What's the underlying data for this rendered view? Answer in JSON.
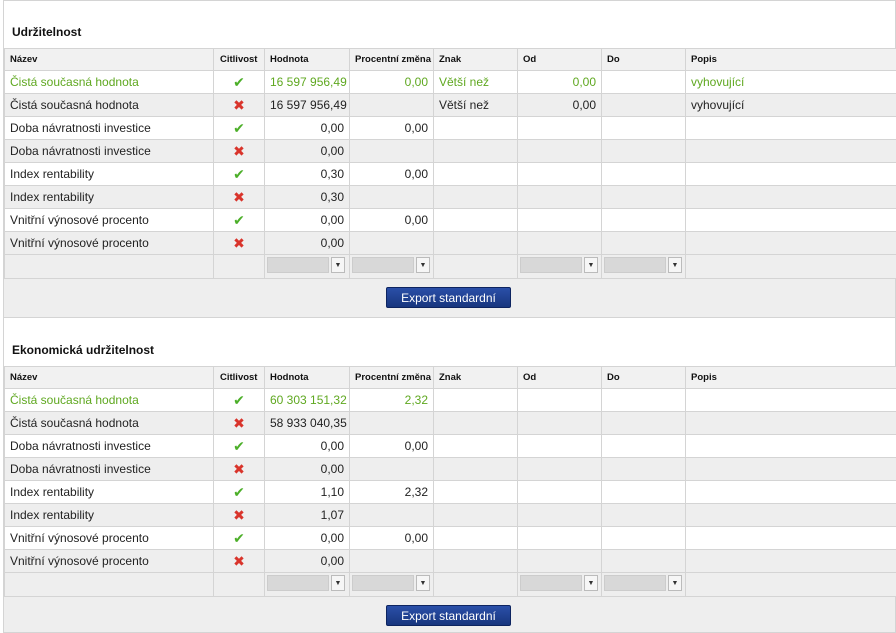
{
  "sections": [
    {
      "title": "Udržitelnost",
      "columns": [
        "Název",
        "Citlivost",
        "Hodnota",
        "Procentní změna",
        "Znak",
        "Od",
        "Do",
        "Popis"
      ],
      "rows": [
        {
          "name": "Čistá současná hodnota",
          "sens": "ok",
          "value": "16 597 956,49",
          "pct": "0,00",
          "sign": "Větší než",
          "from": "0,00",
          "to": "",
          "desc": "vyhovující",
          "green": true
        },
        {
          "name": "Čistá současná hodnota",
          "sens": "bad",
          "value": "16 597 956,49",
          "pct": "",
          "sign": "Větší než",
          "from": "0,00",
          "to": "",
          "desc": "vyhovující",
          "green": false
        },
        {
          "name": "Doba návratnosti investice",
          "sens": "ok",
          "value": "0,00",
          "pct": "0,00",
          "sign": "",
          "from": "",
          "to": "",
          "desc": "",
          "green": false
        },
        {
          "name": "Doba návratnosti investice",
          "sens": "bad",
          "value": "0,00",
          "pct": "",
          "sign": "",
          "from": "",
          "to": "",
          "desc": "",
          "green": false
        },
        {
          "name": "Index rentability",
          "sens": "ok",
          "value": "0,30",
          "pct": "0,00",
          "sign": "",
          "from": "",
          "to": "",
          "desc": "",
          "green": false
        },
        {
          "name": "Index rentability",
          "sens": "bad",
          "value": "0,30",
          "pct": "",
          "sign": "",
          "from": "",
          "to": "",
          "desc": "",
          "green": false
        },
        {
          "name": "Vnitřní výnosové procento",
          "sens": "ok",
          "value": "0,00",
          "pct": "0,00",
          "sign": "",
          "from": "",
          "to": "",
          "desc": "",
          "green": false
        },
        {
          "name": "Vnitřní výnosové procento",
          "sens": "bad",
          "value": "0,00",
          "pct": "",
          "sign": "",
          "from": "",
          "to": "",
          "desc": "",
          "green": false
        }
      ],
      "button": "Export standardní"
    },
    {
      "title": "Ekonomická udržitelnost",
      "columns": [
        "Název",
        "Citlivost",
        "Hodnota",
        "Procentní změna",
        "Znak",
        "Od",
        "Do",
        "Popis"
      ],
      "rows": [
        {
          "name": "Čistá současná hodnota",
          "sens": "ok",
          "value": "60 303 151,32",
          "pct": "2,32",
          "sign": "",
          "from": "",
          "to": "",
          "desc": "",
          "green": true
        },
        {
          "name": "Čistá současná hodnota",
          "sens": "bad",
          "value": "58 933 040,35",
          "pct": "",
          "sign": "",
          "from": "",
          "to": "",
          "desc": "",
          "green": false
        },
        {
          "name": "Doba návratnosti investice",
          "sens": "ok",
          "value": "0,00",
          "pct": "0,00",
          "sign": "",
          "from": "",
          "to": "",
          "desc": "",
          "green": false
        },
        {
          "name": "Doba návratnosti investice",
          "sens": "bad",
          "value": "0,00",
          "pct": "",
          "sign": "",
          "from": "",
          "to": "",
          "desc": "",
          "green": false
        },
        {
          "name": "Index rentability",
          "sens": "ok",
          "value": "1,10",
          "pct": "2,32",
          "sign": "",
          "from": "",
          "to": "",
          "desc": "",
          "green": false
        },
        {
          "name": "Index rentability",
          "sens": "bad",
          "value": "1,07",
          "pct": "",
          "sign": "",
          "from": "",
          "to": "",
          "desc": "",
          "green": false
        },
        {
          "name": "Vnitřní výnosové procento",
          "sens": "ok",
          "value": "0,00",
          "pct": "0,00",
          "sign": "",
          "from": "",
          "to": "",
          "desc": "",
          "green": false
        },
        {
          "name": "Vnitřní výnosové procento",
          "sens": "bad",
          "value": "0,00",
          "pct": "",
          "sign": "",
          "from": "",
          "to": "",
          "desc": "",
          "green": false
        }
      ],
      "button": "Export standardní"
    }
  ],
  "icons": {
    "ok": "check-icon",
    "bad": "cross-icon",
    "dropdown": "chevron-down-icon"
  },
  "colors": {
    "green_text": "#5fa820",
    "check": "#4caf29",
    "cross": "#d9342b",
    "button": "#1c3d8c"
  }
}
